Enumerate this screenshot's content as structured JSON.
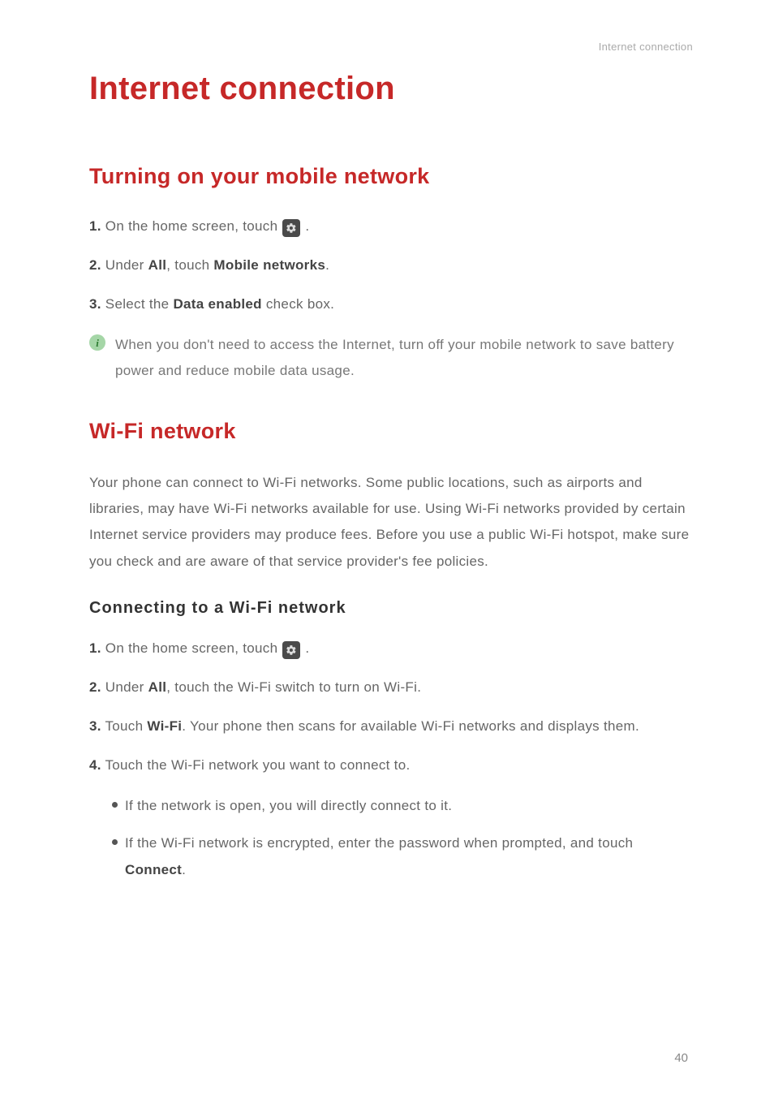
{
  "header": {
    "breadcrumb": "Internet connection"
  },
  "title": "Internet connection",
  "section1": {
    "heading": "Turning on your mobile network",
    "step1_num": "1.",
    "step1_a": " On the home screen, touch ",
    "step1_b": " .",
    "step2_num": "2.",
    "step2_a": " Under ",
    "step2_all": "All",
    "step2_b": ", touch ",
    "step2_mn": "Mobile networks",
    "step2_c": ".",
    "step3_num": "3.",
    "step3_a": " Select the ",
    "step3_de": "Data enabled",
    "step3_b": " check box.",
    "info": "When you don't need to access the Internet, turn off your mobile network to save battery power and reduce mobile data usage."
  },
  "section2": {
    "heading": "Wi-Fi network",
    "intro": "Your phone can connect to Wi-Fi networks. Some public locations, such as airports and libraries, may have Wi-Fi networks available for use. Using Wi-Fi networks provided by certain Internet service providers may produce fees. Before you use a public Wi-Fi hotspot, make sure you check and are aware of that service provider's fee policies.",
    "sub_heading": "Connecting to a Wi-Fi network",
    "s1_num": "1.",
    "s1_a": " On the home screen, touch ",
    "s1_b": " .",
    "s2_num": "2.",
    "s2_a": " Under ",
    "s2_all": "All",
    "s2_b": ", touch the Wi-Fi switch to turn on Wi-Fi.",
    "s3_num": "3.",
    "s3_a": " Touch ",
    "s3_wifi": "Wi-Fi",
    "s3_b": ". Your phone then scans for available Wi-Fi networks and displays them.",
    "s4_num": "4.",
    "s4_a": " Touch the Wi-Fi network you want to connect to.",
    "bullet1": "If the network is open, you will directly connect to it.",
    "bullet2_a": "If the Wi-Fi network is encrypted, enter the password when prompted, and touch ",
    "bullet2_connect": "Connect",
    "bullet2_b": "."
  },
  "page_number": "40",
  "icons": {
    "settings": "settings-icon",
    "info": "info-icon"
  },
  "colors": {
    "accent": "#c62828",
    "body": "#666666",
    "info_bg": "#a5d6a7"
  }
}
